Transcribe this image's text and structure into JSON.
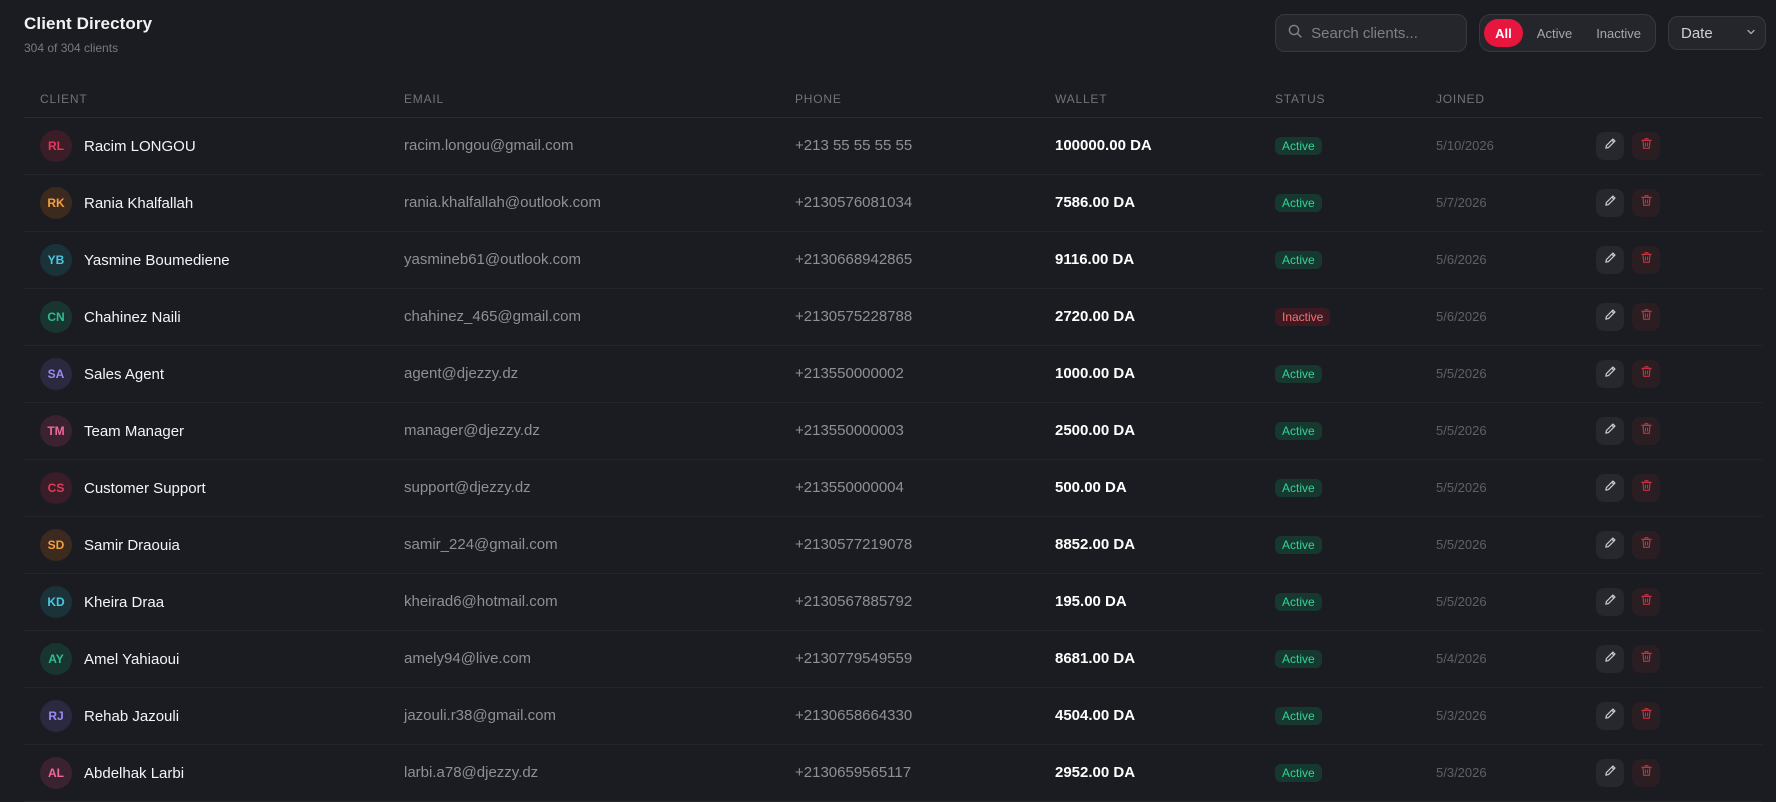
{
  "header": {
    "title": "Client Directory",
    "subtitle": "304 of 304 clients"
  },
  "search": {
    "placeholder": "Search clients..."
  },
  "filters": {
    "all": "All",
    "active": "Active",
    "inactive": "Inactive",
    "selected": "All"
  },
  "sort": {
    "value": "Date"
  },
  "columns": {
    "client": "CLIENT",
    "email": "EMAIL",
    "phone": "PHONE",
    "wallet": "WALLET",
    "status": "STATUS",
    "joined": "JOINED"
  },
  "colors": {
    "accent": "#e6163e",
    "active": "#34d399",
    "inactive": "#f87171"
  },
  "icons": {
    "search": "search-icon",
    "sort": "chevron-down-icon",
    "edit": "pencil-icon",
    "delete": "trash-icon"
  },
  "clients": [
    {
      "initials": "RL",
      "name": "Racim LONGOU",
      "email": "racim.longou@gmail.com",
      "phone": "+213 55 55 55 55",
      "wallet": "100000.00 DA",
      "status": "Active",
      "joined": "5/10/2026",
      "avatar_bg": "#3a1d26",
      "avatar_fg": "#e8375c"
    },
    {
      "initials": "RK",
      "name": "Rania Khalfallah",
      "email": "rania.khalfallah@outlook.com",
      "phone": "+2130576081034",
      "wallet": "7586.00 DA",
      "status": "Active",
      "joined": "5/7/2026",
      "avatar_bg": "#3b2a1d",
      "avatar_fg": "#f59e42"
    },
    {
      "initials": "YB",
      "name": "Yasmine Boumediene",
      "email": "yasmineb61@outlook.com",
      "phone": "+2130668942865",
      "wallet": "9116.00 DA",
      "status": "Active",
      "joined": "5/6/2026",
      "avatar_bg": "#1b3239",
      "avatar_fg": "#4cc6e0"
    },
    {
      "initials": "CN",
      "name": "Chahinez Naili",
      "email": "chahinez_465@gmail.com",
      "phone": "+2130575228788",
      "wallet": "2720.00 DA",
      "status": "Inactive",
      "joined": "5/6/2026",
      "avatar_bg": "#193530",
      "avatar_fg": "#2fbf8f"
    },
    {
      "initials": "SA",
      "name": "Sales Agent",
      "email": "agent@djezzy.dz",
      "phone": "+213550000002",
      "wallet": "1000.00 DA",
      "status": "Active",
      "joined": "5/5/2026",
      "avatar_bg": "#2a2940",
      "avatar_fg": "#9a8cf0"
    },
    {
      "initials": "TM",
      "name": "Team Manager",
      "email": "manager@djezzy.dz",
      "phone": "+213550000003",
      "wallet": "2500.00 DA",
      "status": "Active",
      "joined": "5/5/2026",
      "avatar_bg": "#3a2230",
      "avatar_fg": "#ee6a9c"
    },
    {
      "initials": "CS",
      "name": "Customer Support",
      "email": "support@djezzy.dz",
      "phone": "+213550000004",
      "wallet": "500.00 DA",
      "status": "Active",
      "joined": "5/5/2026",
      "avatar_bg": "#3a1d26",
      "avatar_fg": "#e8375c"
    },
    {
      "initials": "SD",
      "name": "Samir Draouia",
      "email": "samir_224@gmail.com",
      "phone": "+2130577219078",
      "wallet": "8852.00 DA",
      "status": "Active",
      "joined": "5/5/2026",
      "avatar_bg": "#3b2a1d",
      "avatar_fg": "#f59e42"
    },
    {
      "initials": "KD",
      "name": "Kheira Draa",
      "email": "kheirad6@hotmail.com",
      "phone": "+2130567885792",
      "wallet": "195.00 DA",
      "status": "Active",
      "joined": "5/5/2026",
      "avatar_bg": "#1b3239",
      "avatar_fg": "#4cc6e0"
    },
    {
      "initials": "AY",
      "name": "Amel Yahiaoui",
      "email": "amely94@live.com",
      "phone": "+2130779549559",
      "wallet": "8681.00 DA",
      "status": "Active",
      "joined": "5/4/2026",
      "avatar_bg": "#193530",
      "avatar_fg": "#2fbf8f"
    },
    {
      "initials": "RJ",
      "name": "Rehab Jazouli",
      "email": "jazouli.r38@gmail.com",
      "phone": "+2130658664330",
      "wallet": "4504.00 DA",
      "status": "Active",
      "joined": "5/3/2026",
      "avatar_bg": "#2a2940",
      "avatar_fg": "#9a8cf0"
    },
    {
      "initials": "AL",
      "name": "Abdelhak Larbi",
      "email": "larbi.a78@djezzy.dz",
      "phone": "+2130659565117",
      "wallet": "2952.00 DA",
      "status": "Active",
      "joined": "5/3/2026",
      "avatar_bg": "#3a2230",
      "avatar_fg": "#ee6a9c"
    }
  ]
}
